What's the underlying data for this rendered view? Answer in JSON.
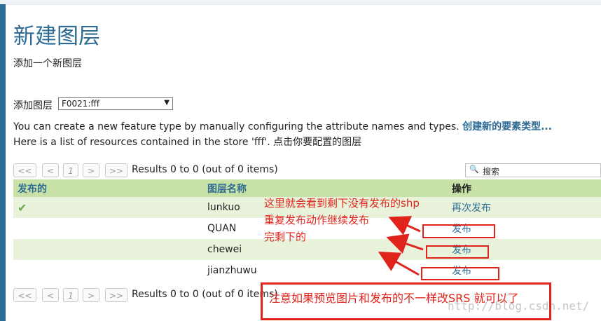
{
  "page": {
    "title": "新建图层",
    "subtitle": "添加一个新图层",
    "add_layer_label": "添加图层",
    "layer_select_value": "F0021:fff",
    "description_text": "You can create a new feature type by manually configuring the attribute names and types.",
    "create_link": "创建新的要素类型...",
    "store_text": "Here is a list of resources contained in the store 'fff'. 点击你要配置的图层"
  },
  "pager": {
    "first": "<<",
    "prev": "<",
    "page": "1",
    "next": ">",
    "last": ">>",
    "info": "Results 0 to 0 (out of 0 items)"
  },
  "search": {
    "placeholder": "搜索",
    "icon": "search-icon"
  },
  "table": {
    "headers": [
      "发布的",
      "图层名称",
      "操作"
    ],
    "rows": [
      {
        "published": true,
        "name": "lunkuo",
        "action": "再次发布"
      },
      {
        "published": false,
        "name": "QUAN",
        "action": "发布"
      },
      {
        "published": false,
        "name": "chewei",
        "action": "发布"
      },
      {
        "published": false,
        "name": "jianzhuwu",
        "action": "发布"
      }
    ]
  },
  "annotations": {
    "line1": "这里就会看到剩下没有发布的shp",
    "line2": "重复发布动作继续发布",
    "line3": "完剩下的",
    "bottom": "注意如果预览图片和发布的不一样改SRS 就可以了"
  },
  "watermark": "http://blog.csdn.net/",
  "colors": {
    "title": "#2d6b94",
    "header_bg": "#c8e1a6",
    "row_alt": "#e9f3dc",
    "annotation": "#e0231b"
  }
}
